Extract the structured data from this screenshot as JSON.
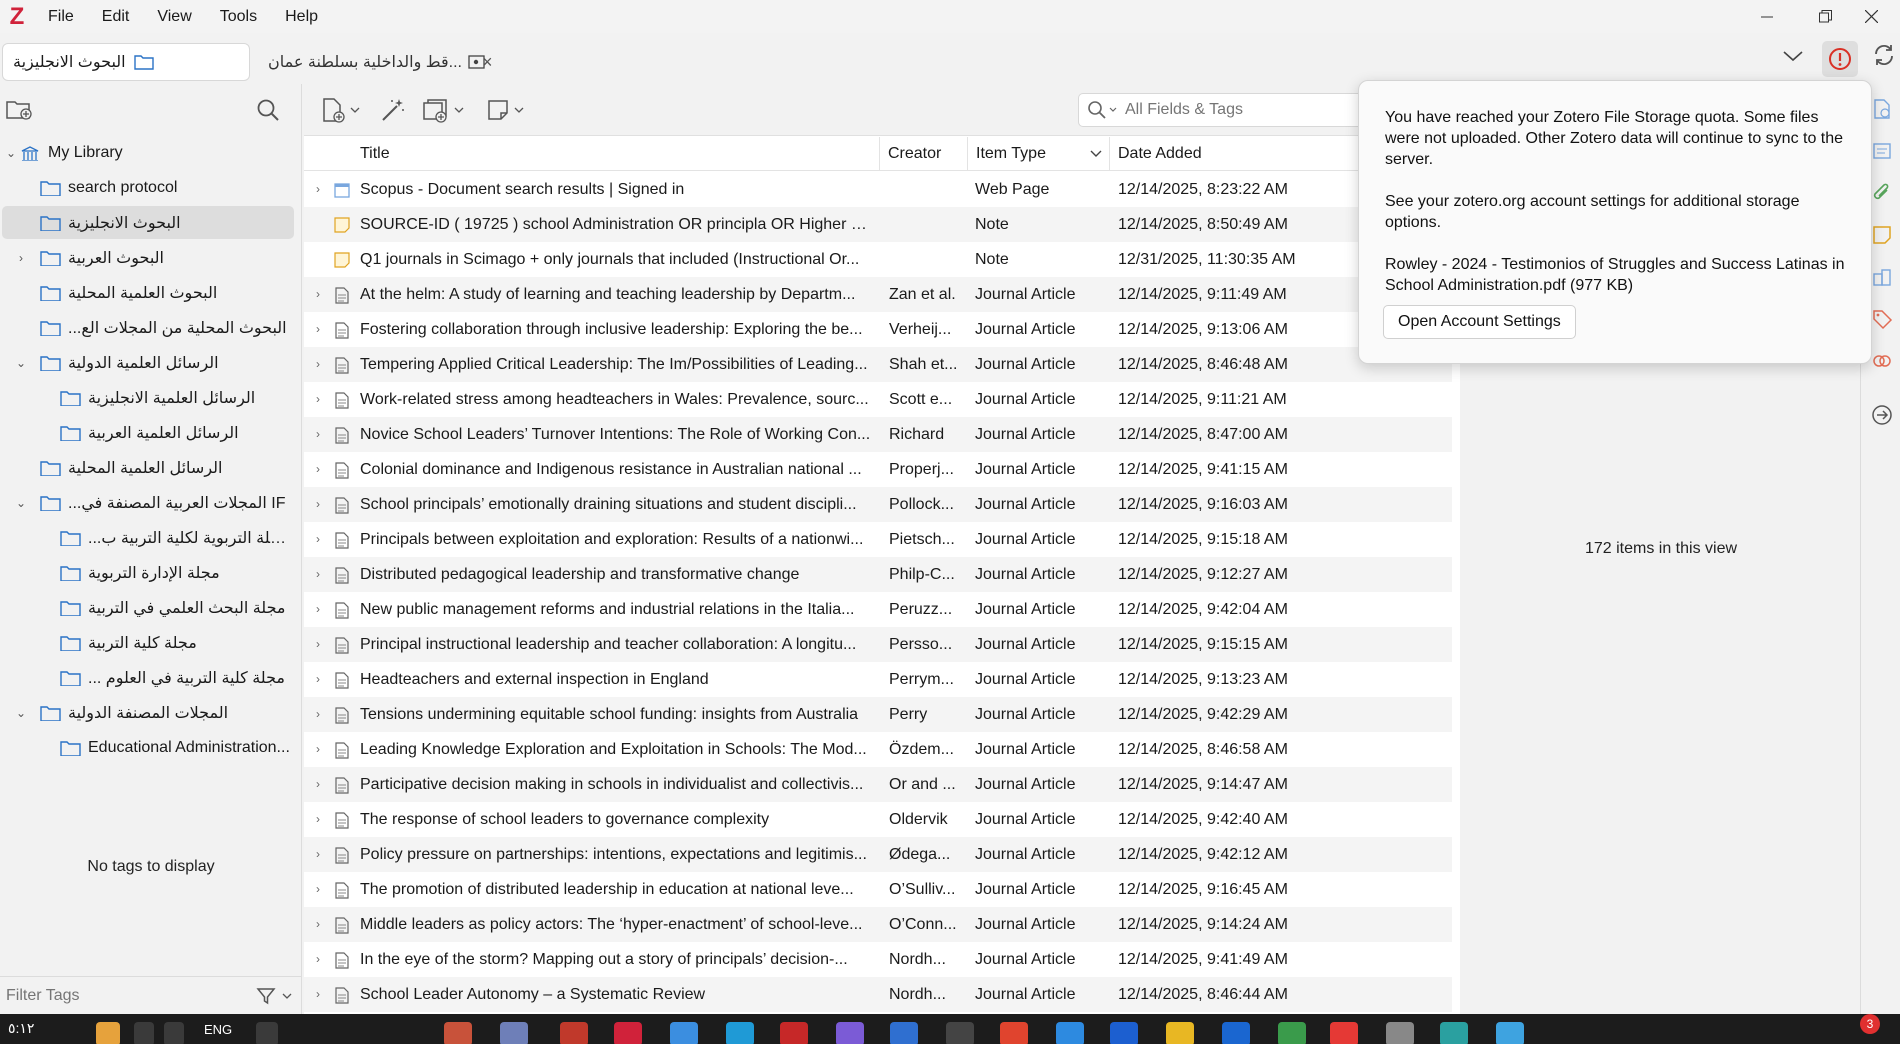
{
  "menu": {
    "app_logo": "Z",
    "items": [
      "File",
      "Edit",
      "View",
      "Tools",
      "Help"
    ]
  },
  "tabs": {
    "library_tab": "البحوث الانجليزية",
    "pdf_tab": "...قط والداخلية بسلطنة عمان",
    "close_glyph": "×"
  },
  "collections": [
    {
      "label": "My Library",
      "level": 0,
      "twisty": "open",
      "icon": "library-icon"
    },
    {
      "label": "search protocol",
      "level": 1,
      "twisty": "none",
      "icon": "folder-icon"
    },
    {
      "label": "البحوث الانجليزية",
      "level": 1,
      "twisty": "none",
      "icon": "folder-icon",
      "selected": true
    },
    {
      "label": "البحوث العربية",
      "level": 1,
      "twisty": "closed",
      "icon": "folder-icon"
    },
    {
      "label": "البحوث العلمية المحلية",
      "level": 1,
      "twisty": "none",
      "icon": "folder-icon"
    },
    {
      "label": "...البحوث المحلية من المجلات الع",
      "level": 1,
      "twisty": "none",
      "icon": "folder-icon"
    },
    {
      "label": "الرسائل العلمية الدولية",
      "level": 1,
      "twisty": "open",
      "icon": "folder-icon"
    },
    {
      "label": "الرسائل العلمية الانجليزية",
      "level": 2,
      "twisty": "none",
      "icon": "folder-icon"
    },
    {
      "label": "الرسائل العلمية العربية",
      "level": 2,
      "twisty": "none",
      "icon": "folder-icon"
    },
    {
      "label": "الرسائل العلمية المحلية",
      "level": 1,
      "twisty": "none",
      "icon": "folder-icon"
    },
    {
      "label": "...المجلات العربية المصنفة في IF",
      "level": 1,
      "twisty": "open",
      "icon": "folder-icon"
    },
    {
      "label": "...المجلة التربوية لكلية التربية ب",
      "level": 2,
      "twisty": "none",
      "icon": "folder-icon"
    },
    {
      "label": "مجلة الإدارة التربوية",
      "level": 2,
      "twisty": "none",
      "icon": "folder-icon"
    },
    {
      "label": "مجلة البحث العلمي في التربية",
      "level": 2,
      "twisty": "none",
      "icon": "folder-icon"
    },
    {
      "label": "مجلة كلية التربية",
      "level": 2,
      "twisty": "none",
      "icon": "folder-icon"
    },
    {
      "label": "... مجلة كلية التربية في العلوم",
      "level": 2,
      "twisty": "none",
      "icon": "folder-icon"
    },
    {
      "label": "المجلات المصنفة الدولية",
      "level": 1,
      "twisty": "open",
      "icon": "folder-icon"
    },
    {
      "label": "Educational Administration...",
      "level": 2,
      "twisty": "none",
      "icon": "folder-icon"
    }
  ],
  "tags": {
    "empty_text": "No tags to display",
    "filter_placeholder": "Filter Tags"
  },
  "search": {
    "placeholder": "All Fields & Tags"
  },
  "columns": {
    "title": "Title",
    "creator": "Creator",
    "item_type": "Item Type",
    "date_added": "Date Added"
  },
  "items": [
    {
      "title": "Scopus - Document search results | Signed in",
      "creator": "",
      "type": "Web Page",
      "date": "12/14/2025, 8:23:22 AM",
      "icon": "webpage-icon",
      "twisty": true
    },
    {
      "title": "SOURCE-ID ( 19725 ) school Administration OR principla OR Higher E...",
      "creator": "",
      "type": "Note",
      "date": "12/14/2025, 8:50:49 AM",
      "icon": "note-icon",
      "twisty": false
    },
    {
      "title": "Q1 journals in Scimago + only journals that included (Instructional Or...",
      "creator": "",
      "type": "Note",
      "date": "12/31/2025, 11:30:35 AM",
      "icon": "note-icon",
      "twisty": false
    },
    {
      "title": "At the helm: A study of learning and teaching leadership by Departm...",
      "creator": "Zan et al.",
      "type": "Journal Article",
      "date": "12/14/2025, 9:11:49 AM",
      "icon": "article-icon",
      "twisty": true
    },
    {
      "title": "Fostering collaboration through inclusive leadership: Exploring the be...",
      "creator": "Verheij...",
      "type": "Journal Article",
      "date": "12/14/2025, 9:13:06 AM",
      "icon": "article-icon",
      "twisty": true
    },
    {
      "title": "Tempering Applied Critical Leadership: The Im/Possibilities of Leading...",
      "creator": "Shah et...",
      "type": "Journal Article",
      "date": "12/14/2025, 8:46:48 AM",
      "icon": "article-icon",
      "twisty": true
    },
    {
      "title": "Work-related stress among headteachers in Wales: Prevalence, sourc...",
      "creator": "Scott e...",
      "type": "Journal Article",
      "date": "12/14/2025, 9:11:21 AM",
      "icon": "article-icon",
      "twisty": true
    },
    {
      "title": "Novice School Leaders’ Turnover Intentions: The Role of Working Con...",
      "creator": "Richard",
      "type": "Journal Article",
      "date": "12/14/2025, 8:47:00 AM",
      "icon": "article-icon",
      "twisty": true
    },
    {
      "title": "Colonial dominance and Indigenous resistance in Australian national ...",
      "creator": "Properj...",
      "type": "Journal Article",
      "date": "12/14/2025, 9:41:15 AM",
      "icon": "article-icon",
      "twisty": true
    },
    {
      "title": "School principals’ emotionally draining situations and student discipli...",
      "creator": "Pollock...",
      "type": "Journal Article",
      "date": "12/14/2025, 9:16:03 AM",
      "icon": "article-icon",
      "twisty": true
    },
    {
      "title": "Principals between exploitation and exploration: Results of a nationwi...",
      "creator": "Pietsch...",
      "type": "Journal Article",
      "date": "12/14/2025, 9:15:18 AM",
      "icon": "article-icon",
      "twisty": true
    },
    {
      "title": "Distributed pedagogical leadership and transformative change",
      "creator": "Philp-C...",
      "type": "Journal Article",
      "date": "12/14/2025, 9:12:27 AM",
      "icon": "article-icon",
      "twisty": true
    },
    {
      "title": "New public management reforms and industrial relations in the Italia...",
      "creator": "Peruzz...",
      "type": "Journal Article",
      "date": "12/14/2025, 9:42:04 AM",
      "icon": "article-icon",
      "twisty": true
    },
    {
      "title": "Principal instructional leadership and teacher collaboration: A longitu...",
      "creator": "Persso...",
      "type": "Journal Article",
      "date": "12/14/2025, 9:15:15 AM",
      "icon": "article-icon",
      "twisty": true
    },
    {
      "title": "Headteachers and external inspection in England",
      "creator": "Perrym...",
      "type": "Journal Article",
      "date": "12/14/2025, 9:13:23 AM",
      "icon": "article-icon",
      "twisty": true
    },
    {
      "title": "Tensions undermining equitable school funding: insights from Australia",
      "creator": "Perry",
      "type": "Journal Article",
      "date": "12/14/2025, 9:42:29 AM",
      "icon": "article-icon",
      "twisty": true
    },
    {
      "title": "Leading Knowledge Exploration and Exploitation in Schools: The Mod...",
      "creator": "Özdem...",
      "type": "Journal Article",
      "date": "12/14/2025, 8:46:58 AM",
      "icon": "article-icon",
      "twisty": true
    },
    {
      "title": "Participative decision making in schools in individualist and collectivis...",
      "creator": "Or and ...",
      "type": "Journal Article",
      "date": "12/14/2025, 9:14:47 AM",
      "icon": "article-icon",
      "twisty": true
    },
    {
      "title": "The response of school leaders to governance complexity",
      "creator": "Oldervik",
      "type": "Journal Article",
      "date": "12/14/2025, 9:42:40 AM",
      "icon": "article-icon",
      "twisty": true
    },
    {
      "title": "Policy pressure on partnerships: intentions, expectations and legitimis...",
      "creator": "Ødega...",
      "type": "Journal Article",
      "date": "12/14/2025, 9:42:12 AM",
      "icon": "article-icon",
      "twisty": true
    },
    {
      "title": "The promotion of distributed leadership in education at national leve...",
      "creator": "O’Sulliv...",
      "type": "Journal Article",
      "date": "12/14/2025, 9:16:45 AM",
      "icon": "article-icon",
      "twisty": true
    },
    {
      "title": "Middle leaders as policy actors: The ‘hyper-enactment’ of school-leve...",
      "creator": "O’Conn...",
      "type": "Journal Article",
      "date": "12/14/2025, 9:14:24 AM",
      "icon": "article-icon",
      "twisty": true
    },
    {
      "title": "In the eye of the storm? Mapping out a story of principals’ decision-...",
      "creator": "Nordh...",
      "type": "Journal Article",
      "date": "12/14/2025, 9:41:49 AM",
      "icon": "article-icon",
      "twisty": true
    },
    {
      "title": "School Leader Autonomy – a Systematic Review",
      "creator": "Nordh...",
      "type": "Journal Article",
      "date": "12/14/2025, 8:46:44 AM",
      "icon": "article-icon",
      "twisty": true
    }
  ],
  "right_pane": {
    "items_count": "172 items in this view"
  },
  "popup": {
    "message1": "You have reached your Zotero File Storage quota. Some files were not uploaded. Other Zotero data will continue to sync to the server.",
    "message2": "See your zotero.org account settings for additional storage options.",
    "file_info": "Rowley - 2024 - Testimonios of Struggles and Success Latinas in School Administration.pdf (977 KB)",
    "button_label": "Open Account Settings"
  },
  "taskbar": {
    "time": "٥:١٢",
    "lang": "ENG",
    "badge": "3"
  },
  "colors": {
    "accent": "#2b73c6",
    "brand": "#d0223a",
    "alert": "#d93025",
    "taskbar": "#1c1c1c"
  }
}
